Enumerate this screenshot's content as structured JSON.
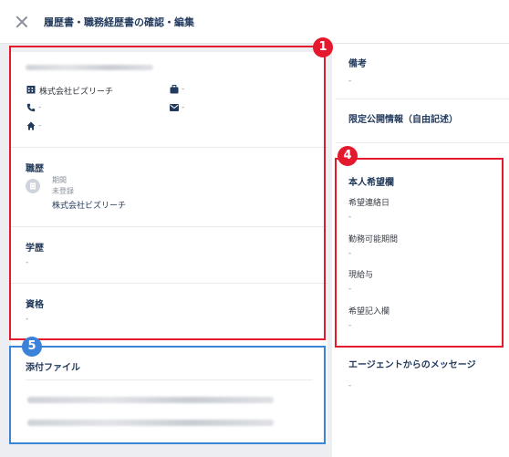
{
  "header": {
    "title": "履歴書・職務経歴書の確認・編集"
  },
  "profile": {
    "company": "株式会社ビズリーチ",
    "phone": "-",
    "home": "-",
    "job": "-",
    "mail": "-"
  },
  "career": {
    "title": "職歴",
    "period_label": "期間",
    "period_value": "未登録",
    "company": "株式会社ビズリーチ"
  },
  "education": {
    "title": "学歴",
    "value": "-"
  },
  "license": {
    "title": "資格",
    "value": "-"
  },
  "attachments": {
    "title": "添付ファイル"
  },
  "right": {
    "notes_title": "備考",
    "notes_value": "-",
    "limited_title": "限定公開情報（自由記述）",
    "wish_title": "本人希望欄",
    "contact_label": "希望連絡日",
    "contact_value": "-",
    "period_label": "勤務可能期間",
    "period_value": "-",
    "salary_label": "現給与",
    "salary_value": "-",
    "free_label": "希望記入欄",
    "free_value": "-",
    "agent_title": "エージェントからのメッセージ",
    "agent_value": "-"
  },
  "annotations": {
    "badge1": "1",
    "badge4": "4",
    "badge5": "5",
    "red": "#e5192d",
    "blue": "#3b82d9"
  }
}
